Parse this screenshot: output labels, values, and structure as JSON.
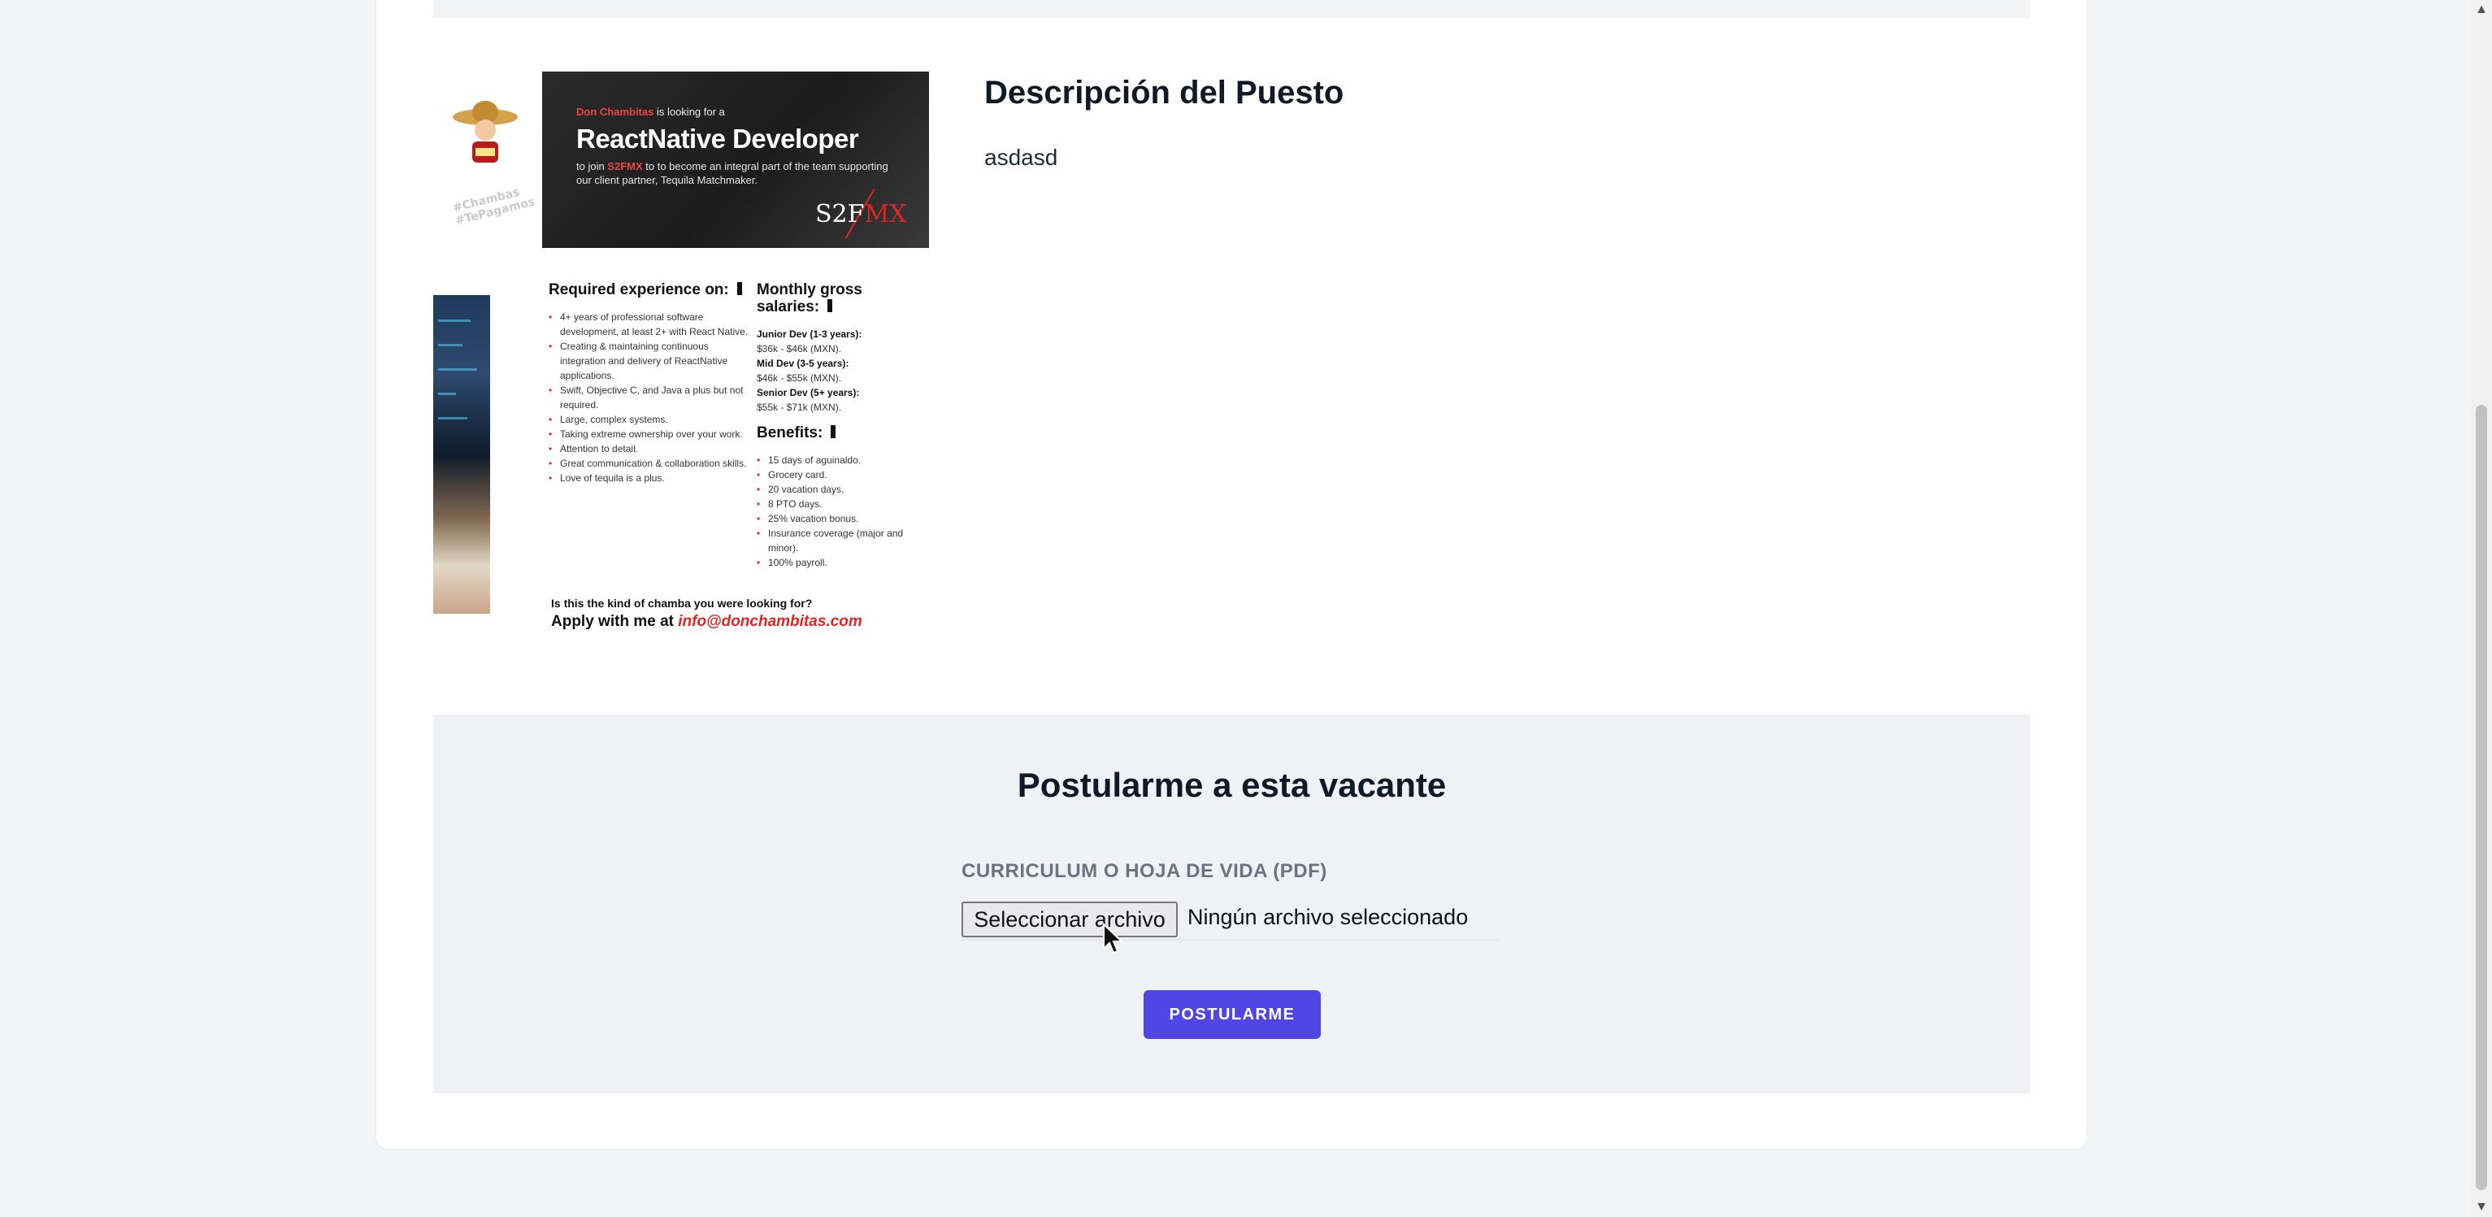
{
  "job": {
    "description_title": "Descripción del Puesto",
    "description_body": "asdasd"
  },
  "flyer": {
    "tag": "#Chambas #TePagamos",
    "headline_prefix": "Don Chambitas",
    "headline_suffix": " is looking for a",
    "role": "ReactNative Developer",
    "intro_pre": "to join ",
    "intro_company": "S2FMX",
    "intro_post": " to to become an integral part of the team supporting our client partner, Tequila Matchmaker.",
    "logo_text": "S2F",
    "logo_accent": "MX",
    "required_title": "Required experience on:",
    "required_items": [
      "4+ years of professional software development, at least 2+ with React Native.",
      "Creating & maintaining continuous integration and delivery of ReactNative applications.",
      "Swift, Objective C, and Java a plus but not required.",
      "Large, complex systems.",
      "Taking extreme ownership over your work.",
      "Attention to detail.",
      "Great communication & collaboration skills.",
      "Love of tequila is a plus."
    ],
    "salaries_title": "Monthly gross salaries:",
    "salaries": [
      {
        "level": "Junior Dev (1-3 years):",
        "range": "$36k - $46k (MXN)."
      },
      {
        "level": "Mid Dev (3-5 years):",
        "range": "$46k - $55k (MXN)."
      },
      {
        "level": "Senior Dev (5+ years):",
        "range": "$55k - $71k (MXN)."
      }
    ],
    "benefits_title": "Benefits:",
    "benefits": [
      "15 days of aguinaldo.",
      "Grocery card.",
      "20 vacation days.",
      "8 PTO days.",
      "25% vacation bonus.",
      "Insurance coverage (major and minor).",
      "100% payroll."
    ],
    "footer_question": "Is this the kind of chamba you were looking for?",
    "footer_apply": "Apply with me at ",
    "footer_email": "info@donchambitas.com"
  },
  "apply": {
    "title": "Postularme a esta vacante",
    "cv_label": "CURRICULUM O HOJA DE VIDA (PDF)",
    "file_button": "Seleccionar archivo",
    "file_status": "Ningún archivo seleccionado",
    "submit_label": "POSTULARME"
  },
  "colors": {
    "accent": "#4f46e5",
    "panel_bg": "#f0f1f4",
    "page_bg": "#f3f4f6",
    "flyer_red": "#dc2626"
  },
  "icons": {
    "scroll_up": "▲",
    "scroll_down": "▼"
  }
}
